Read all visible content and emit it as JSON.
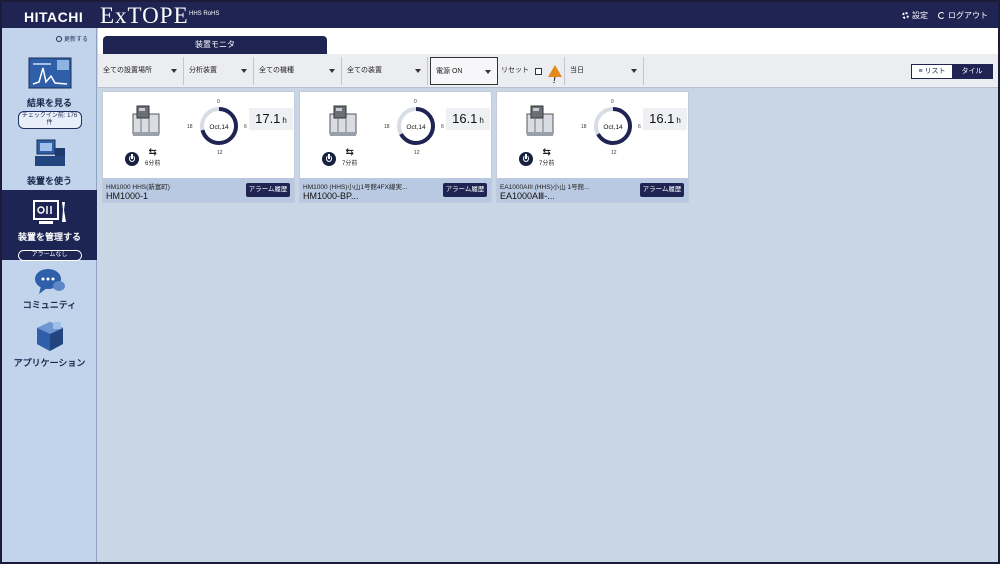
{
  "header": {
    "brand": "HITACHI",
    "product": "ExTOPE",
    "product_sub": "HHS RoHS",
    "settings_label": "設定",
    "logout_label": "ログアウト"
  },
  "sidebar": {
    "refresh_label": "更新する",
    "items": [
      {
        "label": "結果を見る",
        "badge": "チェックイン前: 176件",
        "icon": "spectrum-results-icon"
      },
      {
        "label": "装置を使う",
        "icon": "device-use-icon"
      },
      {
        "label": "装置を管理する",
        "badge": "アラームなし",
        "icon": "device-manage-icon",
        "active": true
      },
      {
        "label": "コミュニティ",
        "icon": "community-chat-icon"
      },
      {
        "label": "アプリケーション",
        "icon": "application-cubes-icon"
      }
    ]
  },
  "tabs": [
    {
      "label": "装置モニタ"
    }
  ],
  "filters": {
    "location": "全ての設置場所",
    "analyzer": "分析装置",
    "model": "全ての機種",
    "device": "全ての装置",
    "power": "電源 ON",
    "reset_label": "リセット",
    "period": "当日",
    "view_list": "リスト",
    "view_tile": "タイル"
  },
  "tiles": [
    {
      "date": "Oct,14",
      "hours": "17.1",
      "unit": "h",
      "ago": "6分前",
      "line1": "HM1000 HHS(新富町)",
      "line2": "HM1000-1",
      "alarm": "アラーム履歴",
      "dial_labels": [
        "0",
        "6",
        "12",
        "18"
      ],
      "usage_fraction": 0.71
    },
    {
      "date": "Oct,14",
      "hours": "16.1",
      "unit": "h",
      "ago": "7分前",
      "line1": "HM1000 (HHS)小山1号館4FX線実...",
      "line2": "HM1000-BP...",
      "alarm": "アラーム履歴",
      "dial_labels": [
        "0",
        "6",
        "12",
        "18"
      ],
      "usage_fraction": 0.67
    },
    {
      "date": "Oct,14",
      "hours": "16.1",
      "unit": "h",
      "ago": "7分前",
      "line1": "EA1000AIII (HHS)小山 1号館...",
      "line2": "EA1000AⅢ-...",
      "alarm": "アラーム履歴",
      "dial_labels": [
        "0",
        "6",
        "12",
        "18"
      ],
      "usage_fraction": 0.67
    }
  ],
  "colors": {
    "navy": "#1f2453",
    "panel": "#c9d6e6",
    "warning": "#e38a1b"
  }
}
